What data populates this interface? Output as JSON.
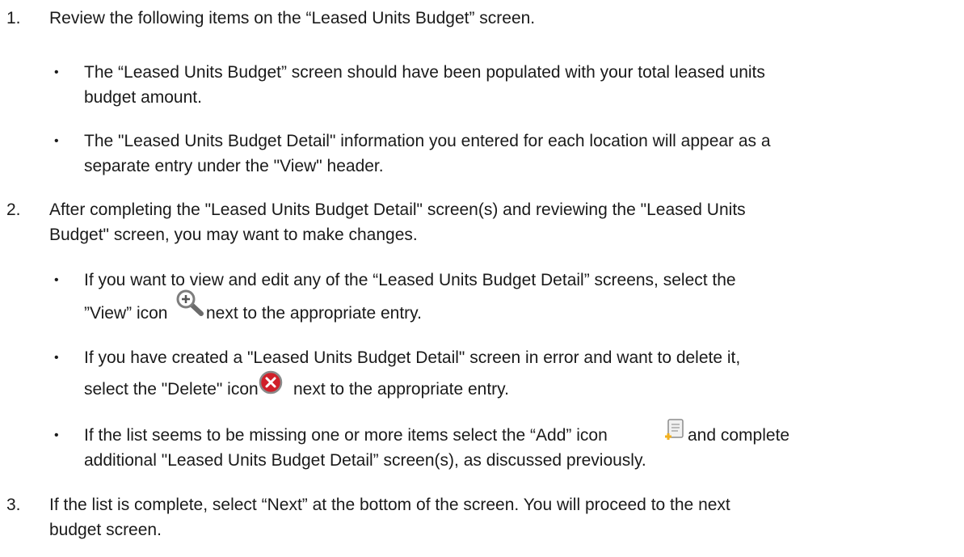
{
  "steps": [
    {
      "number": "1.",
      "text": "Review the following items on the “Leased Units Budget” screen.",
      "bullets": [
        {
          "lines": [
            "The “Leased Units Budget” screen should have been populated with your total leased units",
            "budget amount."
          ]
        },
        {
          "lines": [
            "The \"Leased Units Budget Detail\" information you entered for each location will appear as a",
            "separate entry under the \"View\" header."
          ]
        }
      ]
    },
    {
      "number": "2.",
      "lines": [
        "After completing the \"Leased Units Budget Detail\" screen(s) and reviewing the \"Leased Units",
        "Budget\" screen, you may want to make changes."
      ],
      "bullets": [
        {
          "line1": "If you want to view and edit any of the “Leased Units Budget Detail” screens, select the",
          "line2_before": "”View” icon",
          "icon": "view-magnifier-icon",
          "line2_after": "next to the appropriate entry."
        },
        {
          "line1": "If you have created a \"Leased Units Budget Detail\" screen in error and want to delete it,",
          "line2_before": "select the \"Delete\" icon",
          "icon": "delete-icon",
          "line2_after": "next to the appropriate entry."
        },
        {
          "line1_before": "If the list seems to be missing one or more items select the “Add” icon",
          "icon": "add-document-icon",
          "line1_after": "and complete",
          "line2": "additional \"Leased Units Budget Detail” screen(s), as discussed previously."
        }
      ]
    },
    {
      "number": "3.",
      "lines": [
        "If the list is complete, select “Next” at the bottom of the screen. You will proceed to the next",
        "budget screen."
      ]
    }
  ],
  "bullet_glyph": "•",
  "colors": {
    "text": "#1a1a1a",
    "delete_red": "#d0202a",
    "icon_gray": "#7d7d7d"
  }
}
